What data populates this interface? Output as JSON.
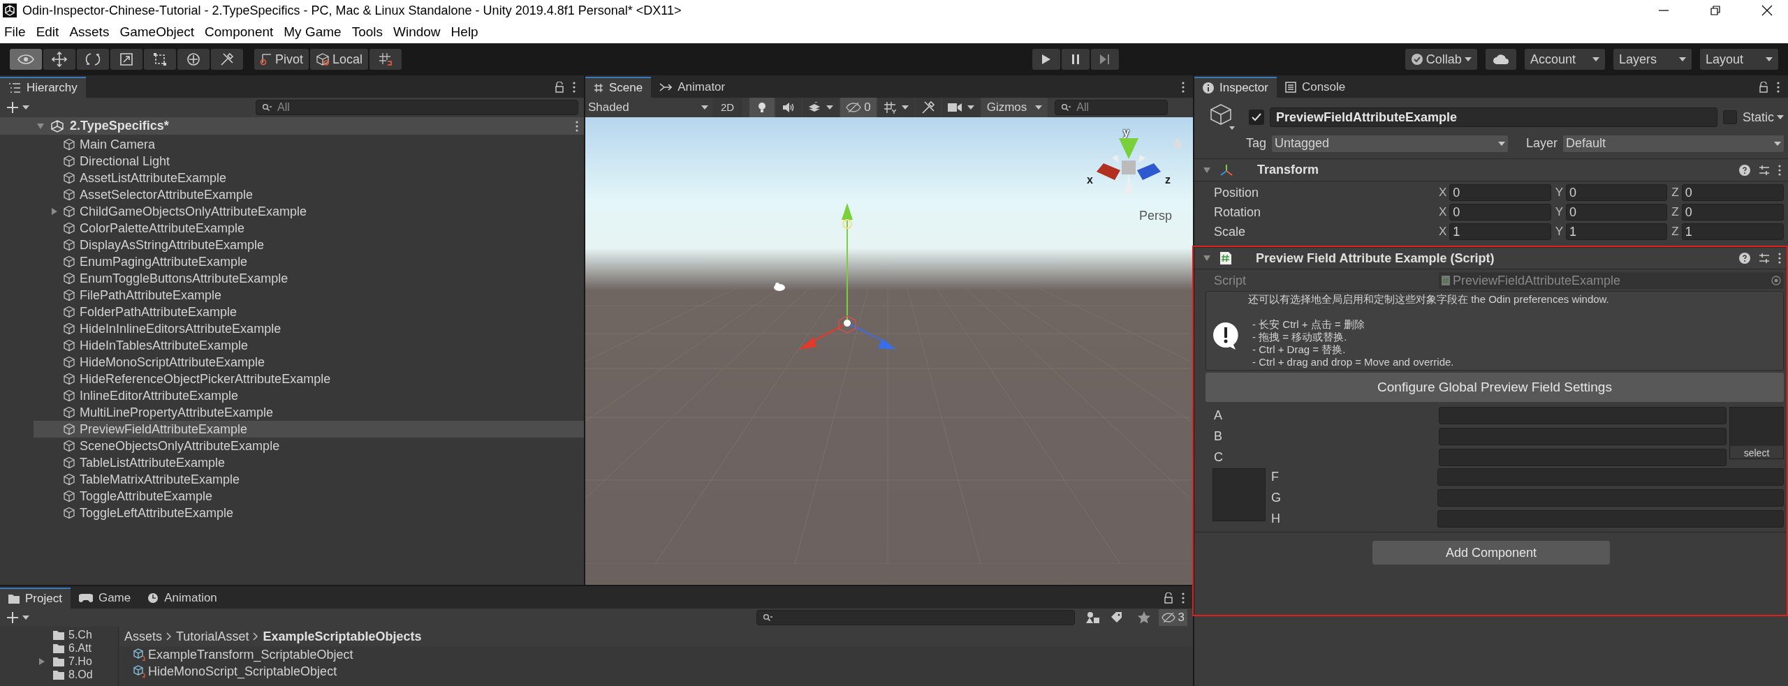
{
  "window": {
    "title": "Odin-Inspector-Chinese-Tutorial - 2.TypeSpecifics - PC, Mac & Linux Standalone - Unity 2019.4.8f1 Personal* <DX11>"
  },
  "menu": [
    "File",
    "Edit",
    "Assets",
    "GameObject",
    "Component",
    "My Game",
    "Tools",
    "Window",
    "Help"
  ],
  "toolbar": {
    "tools": [
      {
        "kind": "view",
        "selected": true
      },
      {
        "kind": "move",
        "selected": false
      },
      {
        "kind": "rotate",
        "selected": false
      },
      {
        "kind": "scale",
        "selected": false
      },
      {
        "kind": "rect",
        "selected": false
      },
      {
        "kind": "transform",
        "selected": false
      },
      {
        "kind": "custom",
        "selected": false
      }
    ],
    "pivot": "Pivot",
    "local": "Local",
    "collab": "Collab",
    "account": "Account",
    "layers": "Layers",
    "layout": "Layout"
  },
  "hierarchy": {
    "tab": "Hierarchy",
    "search_placeholder": "All",
    "scene": {
      "name": "2.TypeSpecifics*",
      "expanded": true
    },
    "items": [
      {
        "name": "Main Camera",
        "selected": false,
        "has_children": false
      },
      {
        "name": "Directional Light",
        "selected": false,
        "has_children": false
      },
      {
        "name": "AssetListAttributeExample",
        "selected": false,
        "has_children": false
      },
      {
        "name": "AssetSelectorAttributeExample",
        "selected": false,
        "has_children": false
      },
      {
        "name": "ChildGameObjectsOnlyAttributeExample",
        "selected": false,
        "has_children": true
      },
      {
        "name": "ColorPaletteAttributeExample",
        "selected": false,
        "has_children": false
      },
      {
        "name": "DisplayAsStringAttributeExample",
        "selected": false,
        "has_children": false
      },
      {
        "name": "EnumPagingAttributeExample",
        "selected": false,
        "has_children": false
      },
      {
        "name": "EnumToggleButtonsAttributeExample",
        "selected": false,
        "has_children": false
      },
      {
        "name": "FilePathAttributeExample",
        "selected": false,
        "has_children": false
      },
      {
        "name": "FolderPathAttributeExample",
        "selected": false,
        "has_children": false
      },
      {
        "name": "HideInInlineEditorsAttributeExample",
        "selected": false,
        "has_children": false
      },
      {
        "name": "HideInTablesAttributeExample",
        "selected": false,
        "has_children": false
      },
      {
        "name": "HideMonoScriptAttributeExample",
        "selected": false,
        "has_children": false
      },
      {
        "name": "HideReferenceObjectPickerAttributeExample",
        "selected": false,
        "has_children": false
      },
      {
        "name": "InlineEditorAttributeExample",
        "selected": false,
        "has_children": false
      },
      {
        "name": "MultiLinePropertyAttributeExample",
        "selected": false,
        "has_children": false
      },
      {
        "name": "PreviewFieldAttributeExample",
        "selected": true,
        "has_children": false
      },
      {
        "name": "SceneObjectsOnlyAttributeExample",
        "selected": false,
        "has_children": false
      },
      {
        "name": "TableListAttributeExample",
        "selected": false,
        "has_children": false
      },
      {
        "name": "TableMatrixAttributeExample",
        "selected": false,
        "has_children": false
      },
      {
        "name": "ToggleAttributeExample",
        "selected": false,
        "has_children": false
      },
      {
        "name": "ToggleLeftAttributeExample",
        "selected": false,
        "has_children": false
      }
    ]
  },
  "scene_view": {
    "tabs": [
      {
        "label": "Scene",
        "selected": true
      },
      {
        "label": "Animator",
        "selected": false
      }
    ],
    "shading": "Shaded",
    "mode_2d": "2D",
    "lighting": true,
    "hidden_count": "0",
    "gizmos": "Gizmos",
    "search_placeholder": "All",
    "axis_y": "y",
    "axis_x": "x",
    "axis_z": "z",
    "projection": "Persp"
  },
  "inspector": {
    "tabs": [
      {
        "label": "Inspector",
        "selected": true
      },
      {
        "label": "Console",
        "selected": false
      }
    ],
    "object": {
      "active": true,
      "name": "PreviewFieldAttributeExample",
      "static": false,
      "static_label": "Static",
      "tag_label": "Tag",
      "tag": "Untagged",
      "layer_label": "Layer",
      "layer": "Default"
    },
    "transform": {
      "title": "Transform",
      "expanded": true,
      "rows": [
        {
          "label": "Position",
          "values": [
            {
              "axis": "X",
              "value": "0"
            },
            {
              "axis": "Y",
              "value": "0"
            },
            {
              "axis": "Z",
              "value": "0"
            }
          ]
        },
        {
          "label": "Rotation",
          "values": [
            {
              "axis": "X",
              "value": "0"
            },
            {
              "axis": "Y",
              "value": "0"
            },
            {
              "axis": "Z",
              "value": "0"
            }
          ]
        },
        {
          "label": "Scale",
          "values": [
            {
              "axis": "X",
              "value": "1"
            },
            {
              "axis": "Y",
              "value": "1"
            },
            {
              "axis": "Z",
              "value": "1"
            }
          ]
        }
      ]
    },
    "component": {
      "title": "Preview Field Attribute Example (Script)",
      "expanded": true,
      "script_label": "Script",
      "script": "PreviewFieldAttributeExample",
      "info_heading": "还可以有选择地全局启用和定制这些对象字段在 the Odin preferences window.",
      "info_lines": [
        "- 长安 Ctrl + 点击 = 删除",
        "- 拖拽 = 移动或替换.",
        "- Ctrl + Drag = 替换.",
        "- Ctrl + drag and drop = Move and override."
      ],
      "configure_button": "Configure Global Preview Field Settings",
      "fields_top": [
        "A",
        "B",
        "C"
      ],
      "preview_select": "select",
      "fields_bottom": [
        "F",
        "G",
        "H"
      ]
    },
    "add_component": "Add Component"
  },
  "project": {
    "tabs": [
      {
        "label": "Project",
        "selected": true
      },
      {
        "label": "Game",
        "selected": false
      },
      {
        "label": "Animation",
        "selected": false
      }
    ],
    "folders": [
      {
        "name": "5.Ch",
        "has_children": false
      },
      {
        "name": "6.Att",
        "has_children": false
      },
      {
        "name": "7.Ho",
        "has_children": true
      },
      {
        "name": "8.Od",
        "has_children": false
      }
    ],
    "breadcrumb": [
      "Assets",
      "TutorialAsset",
      "ExampleScriptableObjects"
    ],
    "assets": [
      "ExampleTransform_ScriptableObject",
      "HideMonoScript_ScriptableObject"
    ],
    "hidden_count": "3"
  }
}
